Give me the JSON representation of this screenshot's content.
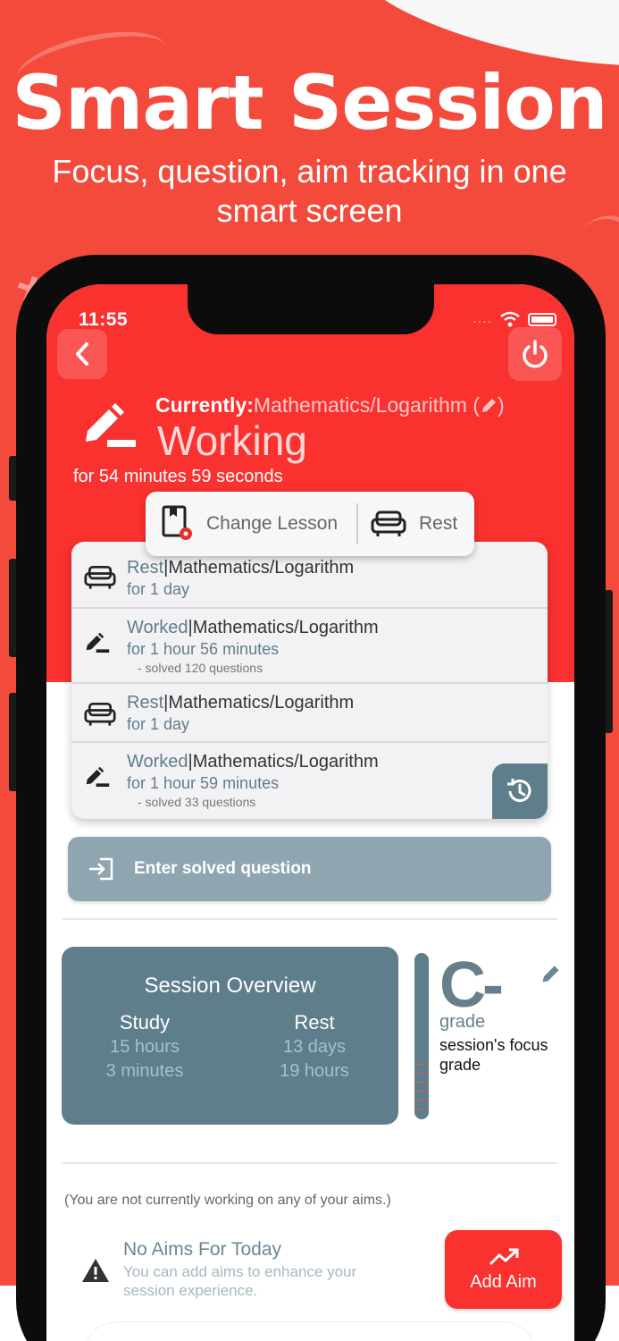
{
  "hero": {
    "title": "Smart Session",
    "subtitle": "Focus, question, aim tracking in one smart screen"
  },
  "status_bar": {
    "time": "11:55",
    "signal": "....",
    "icons": [
      "wifi-icon",
      "battery-icon"
    ]
  },
  "header": {
    "back_icon": "chevron-left-icon",
    "power_icon": "power-icon",
    "currently_label": "Currently:",
    "current_subject": "Mathematics/Logarithm (",
    "current_subject_close": ")",
    "state": "Working",
    "duration": "for 54 minutes 59 seconds"
  },
  "actions": {
    "change_lesson": "Change Lesson",
    "rest": "Rest"
  },
  "history": [
    {
      "state": "Rest",
      "subject": "|Mathematics/Logarithm",
      "duration": "for 1 day",
      "detail": ""
    },
    {
      "state": "Worked",
      "subject": "|Mathematics/Logarithm",
      "duration": "for 1 hour 56 minutes",
      "detail": "- solved 120 questions"
    },
    {
      "state": "Rest",
      "subject": "|Mathematics/Logarithm",
      "duration": "for 1 day",
      "detail": ""
    },
    {
      "state": "Worked",
      "subject": "|Mathematics/Logarithm",
      "duration": "for 1 hour 59 minutes",
      "detail": "- solved 33 questions"
    }
  ],
  "enter_question": {
    "label": "Enter solved question"
  },
  "overview": {
    "title": "Session Overview",
    "study_label": "Study",
    "study_value_1": "15 hours",
    "study_value_2": "3 minutes",
    "rest_label": "Rest",
    "rest_value_1": "13 days",
    "rest_value_2": "19 hours"
  },
  "grade": {
    "letter": "C-",
    "word": "grade",
    "description": "session's focus grade"
  },
  "aims": {
    "note": "(You are not currently working on any of your aims.)",
    "title": "No Aims For Today",
    "text": "You can add aims to enhance your session experience.",
    "add_label": "Add Aim"
  },
  "colors": {
    "brand_red": "#f9312f",
    "slate": "#5f7e8b",
    "slate_light": "#8fa6b0"
  }
}
